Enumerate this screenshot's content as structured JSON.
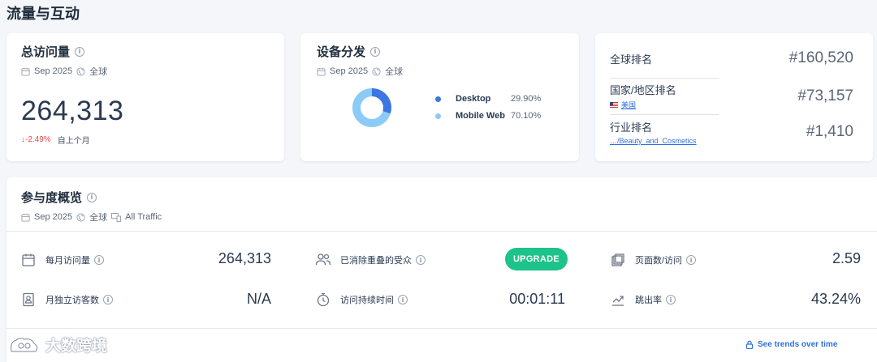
{
  "page": {
    "section_title": "流量与互动"
  },
  "total_visits": {
    "title": "总访问量",
    "period": "Sep 2025",
    "region": "全球",
    "value": "264,313",
    "change": "-2.49%",
    "change_label": "自上个月"
  },
  "device": {
    "title": "设备分发",
    "period": "Sep 2025",
    "region": "全球",
    "items": [
      {
        "name": "Desktop",
        "pct": "29.90%",
        "value": 29.9,
        "color": "#3b76e1"
      },
      {
        "name": "Mobile Web",
        "pct": "70.10%",
        "value": 70.1,
        "color": "#8ccbf8"
      }
    ]
  },
  "ranks": {
    "global": {
      "label": "全球排名",
      "value": "#160,520"
    },
    "country": {
      "label": "国家/地区排名",
      "sub": "美国",
      "value": "#73,157"
    },
    "industry": {
      "label": "行业排名",
      "sub": "…/Beauty_and_Cosmetics",
      "value": "#1,410"
    }
  },
  "engagement": {
    "title": "参与度概览",
    "period": "Sep 2025",
    "region": "全球",
    "traffic": "All Traffic",
    "monthly_visits": {
      "label": "每月访问量",
      "value": "264,313"
    },
    "unique_visitors": {
      "label": "月独立访客数",
      "value": "N/A"
    },
    "dedup_audience": {
      "label": "已消除重叠的受众"
    },
    "upgrade_label": "UPGRADE",
    "visit_duration": {
      "label": "访问持续时间",
      "value": "00:01:11"
    },
    "pages_per_visit": {
      "label": "页面数/访问",
      "value": "2.59"
    },
    "bounce_rate": {
      "label": "跳出率",
      "value": "43.24%"
    },
    "trends_link": "See trends over time"
  },
  "watermark": {
    "text": "大数跨境"
  }
}
